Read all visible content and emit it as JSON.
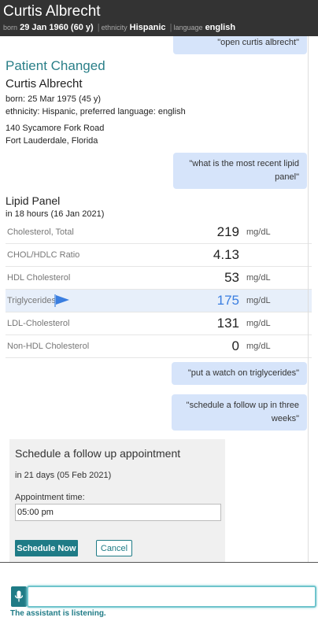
{
  "header": {
    "patient_name": "Curtis Albrecht",
    "born_label": "born",
    "born_value": "29 Jan 1960 (60 y)",
    "ethnicity_label": "ethnicity",
    "ethnicity_value": "Hispanic",
    "language_label": "language",
    "language_value": "english"
  },
  "messages": {
    "open_patient": "\"open curtis albrecht\"",
    "lipid_query": "\"what is the most recent lipid panel\"",
    "watch": "\"put a watch on triglycerides\"",
    "schedule": "\"schedule a follow up in three weeks\""
  },
  "patient_changed": {
    "title": "Patient Changed",
    "name": "Curtis Albrecht",
    "born": "born: 25 Mar 1975 (45 y)",
    "ethnicity_language": "ethnicity: Hispanic, preferred language: english",
    "address_line1": "140 Sycamore Fork Road",
    "address_line2": "Fort Lauderdale, Florida"
  },
  "lipid_panel": {
    "title": "Lipid Panel",
    "when": "in 18 hours (16 Jan 2021)",
    "rows": [
      {
        "name": "Cholesterol, Total",
        "value": "219",
        "unit": "mg/dL"
      },
      {
        "name": "CHOL/HDLC Ratio",
        "value": "4.13",
        "unit": ""
      },
      {
        "name": "HDL Cholesterol",
        "value": "53",
        "unit": "mg/dL"
      },
      {
        "name": "Triglycerides",
        "value": "175",
        "unit": "mg/dL",
        "flagged": true,
        "icon": "flag-icon",
        "highlight_color": "#3a7ee0"
      },
      {
        "name": "LDL-Cholesterol",
        "value": "131",
        "unit": "mg/dL"
      },
      {
        "name": "Non-HDL Cholesterol",
        "value": "0",
        "unit": "mg/dL"
      }
    ]
  },
  "schedule_card": {
    "title": "Schedule a follow up appointment",
    "when": "in 21 days (05 Feb 2021)",
    "time_label": "Appointment time:",
    "time_value": "05:00 pm",
    "schedule_button": "Schedule Now",
    "cancel_button": "Cancel"
  },
  "assistant": {
    "mic_icon": "microphone-icon",
    "input_value": "",
    "status": "The assistant is listening."
  },
  "colors": {
    "accent": "#1f7b86",
    "header_bg": "#333333",
    "bubble_bg": "#d6e4fa",
    "flag_blue": "#3a7ee0"
  }
}
